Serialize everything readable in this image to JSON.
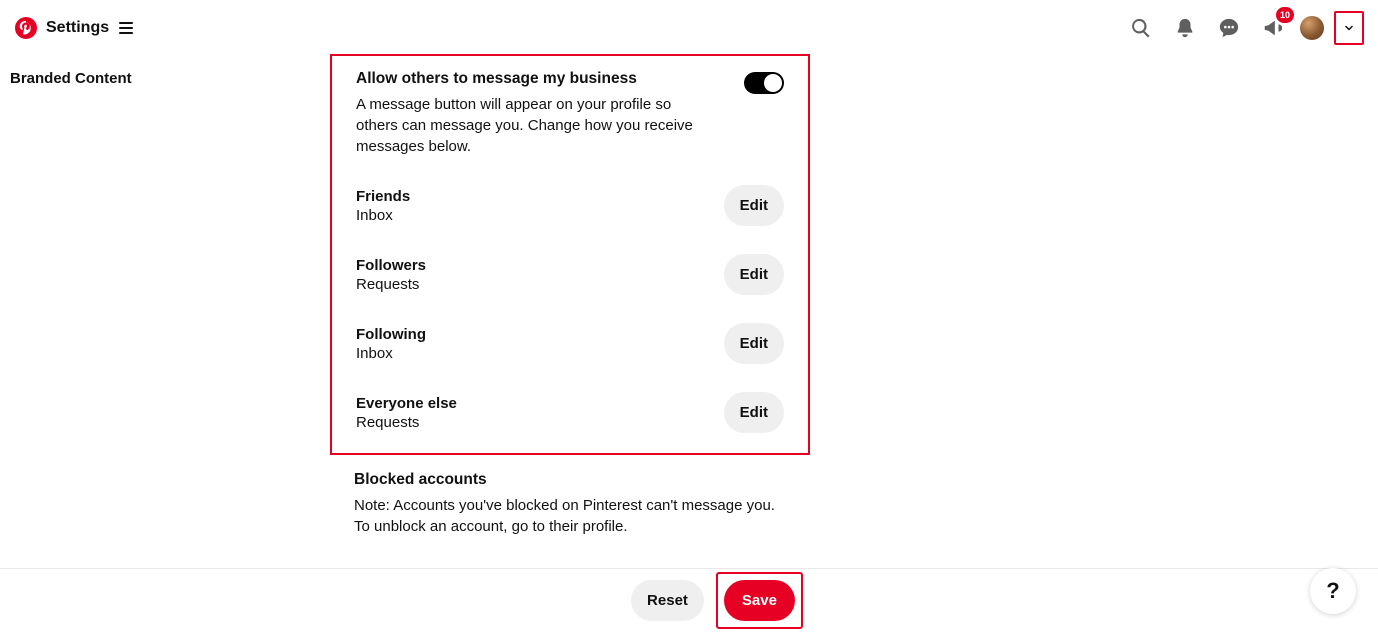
{
  "header": {
    "page_title": "Settings",
    "notifications_badge": "10"
  },
  "sidebar": {
    "items": [
      {
        "label": "Branded Content"
      }
    ]
  },
  "messaging": {
    "section_title": "Allow others to message my business",
    "section_desc": "A message button will appear on your profile so others can message you. Change how you receive messages below.",
    "toggle_on": true,
    "groups": [
      {
        "label": "Friends",
        "value": "Inbox",
        "edit": "Edit"
      },
      {
        "label": "Followers",
        "value": "Requests",
        "edit": "Edit"
      },
      {
        "label": "Following",
        "value": "Inbox",
        "edit": "Edit"
      },
      {
        "label": "Everyone else",
        "value": "Requests",
        "edit": "Edit"
      }
    ]
  },
  "blocked": {
    "title": "Blocked accounts",
    "note": "Note: Accounts you've blocked on Pinterest can't message you. To unblock an account, go to their profile."
  },
  "footer": {
    "reset": "Reset",
    "save": "Save"
  },
  "help": {
    "label": "?"
  }
}
